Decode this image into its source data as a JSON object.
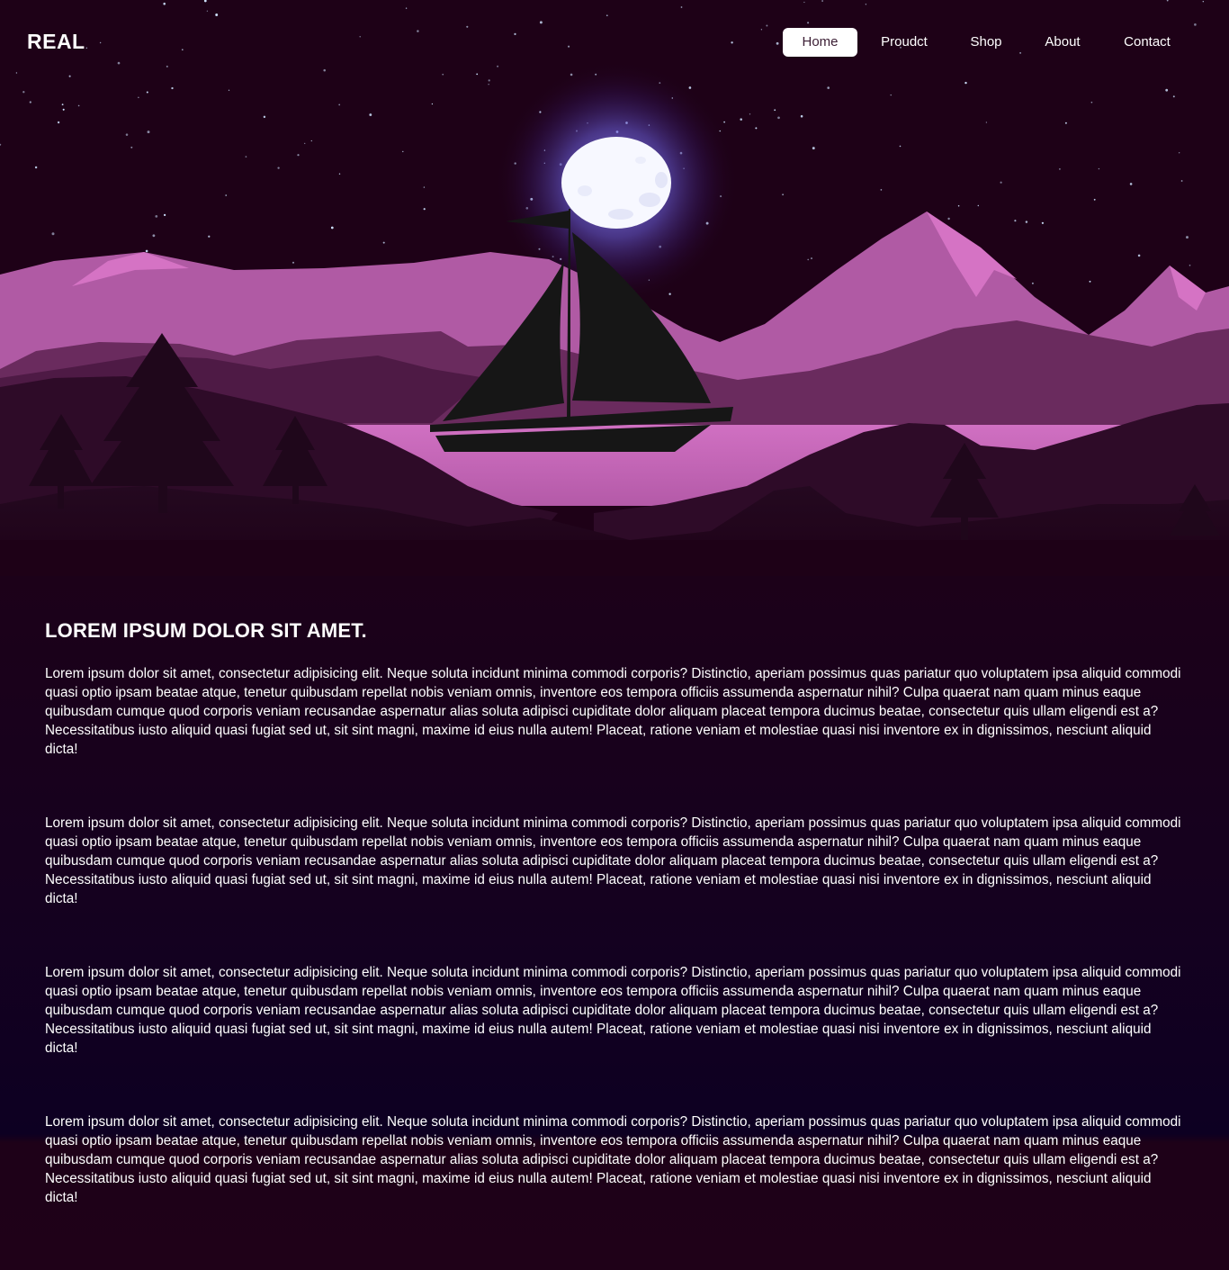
{
  "brand": {
    "logo": "REAL"
  },
  "nav": {
    "items": [
      {
        "label": "Home",
        "active": true
      },
      {
        "label": "Proudct",
        "active": false
      },
      {
        "label": "Shop",
        "active": false
      },
      {
        "label": "About",
        "active": false
      },
      {
        "label": "Contact",
        "active": false
      }
    ]
  },
  "hero": {
    "illustration": "night-landscape-with-moon-mountains-lake-and-sailboat",
    "colors": {
      "sky": "#1e0117",
      "moon": "#f4f6ff",
      "moon_glow": "#7a74f0",
      "mountain_far": "#b55aa6",
      "mountain_mid": "#5a234f",
      "lake": "#c76bbd",
      "hills_dark": "#2b0a25",
      "sailboat": "#161616"
    }
  },
  "main": {
    "heading": "LOREM IPSUM DOLOR SIT AMET.",
    "paragraphs": [
      "Lorem ipsum dolor sit amet, consectetur adipisicing elit. Neque soluta incidunt minima commodi corporis? Distinctio, aperiam possimus quas pariatur quo voluptatem ipsa aliquid commodi quasi optio ipsam beatae atque, tenetur quibusdam repellat nobis veniam omnis, inventore eos tempora officiis assumenda aspernatur nihil? Culpa quaerat nam quam minus eaque quibusdam cumque quod corporis veniam recusandae aspernatur alias soluta adipisci cupiditate dolor aliquam placeat tempora ducimus beatae, consectetur quis ullam eligendi est a? Necessitatibus iusto aliquid quasi fugiat sed ut, sit sint magni, maxime id eius nulla autem! Placeat, ratione veniam et molestiae quasi nisi inventore ex in dignissimos, nesciunt aliquid dicta!",
      "Lorem ipsum dolor sit amet, consectetur adipisicing elit. Neque soluta incidunt minima commodi corporis? Distinctio, aperiam possimus quas pariatur quo voluptatem ipsa aliquid commodi quasi optio ipsam beatae atque, tenetur quibusdam repellat nobis veniam omnis, inventore eos tempora officiis assumenda aspernatur nihil? Culpa quaerat nam quam minus eaque quibusdam cumque quod corporis veniam recusandae aspernatur alias soluta adipisci cupiditate dolor aliquam placeat tempora ducimus beatae, consectetur quis ullam eligendi est a? Necessitatibus iusto aliquid quasi fugiat sed ut, sit sint magni, maxime id eius nulla autem! Placeat, ratione veniam et molestiae quasi nisi inventore ex in dignissimos, nesciunt aliquid dicta!",
      "Lorem ipsum dolor sit amet, consectetur adipisicing elit. Neque soluta incidunt minima commodi corporis? Distinctio, aperiam possimus quas pariatur quo voluptatem ipsa aliquid commodi quasi optio ipsam beatae atque, tenetur quibusdam repellat nobis veniam omnis, inventore eos tempora officiis assumenda aspernatur nihil? Culpa quaerat nam quam minus eaque quibusdam cumque quod corporis veniam recusandae aspernatur alias soluta adipisci cupiditate dolor aliquam placeat tempora ducimus beatae, consectetur quis ullam eligendi est a? Necessitatibus iusto aliquid quasi fugiat sed ut, sit sint magni, maxime id eius nulla autem! Placeat, ratione veniam et molestiae quasi nisi inventore ex in dignissimos, nesciunt aliquid dicta!",
      "Lorem ipsum dolor sit amet, consectetur adipisicing elit. Neque soluta incidunt minima commodi corporis? Distinctio, aperiam possimus quas pariatur quo voluptatem ipsa aliquid commodi quasi optio ipsam beatae atque, tenetur quibusdam repellat nobis veniam omnis, inventore eos tempora officiis assumenda aspernatur nihil? Culpa quaerat nam quam minus eaque quibusdam cumque quod corporis veniam recusandae aspernatur alias soluta adipisci cupiditate dolor aliquam placeat tempora ducimus beatae, consectetur quis ullam eligendi est a? Necessitatibus iusto aliquid quasi fugiat sed ut, sit sint magni, maxime id eius nulla autem! Placeat, ratione veniam et molestiae quasi nisi inventore ex in dignissimos, nesciunt aliquid dicta!"
    ]
  }
}
